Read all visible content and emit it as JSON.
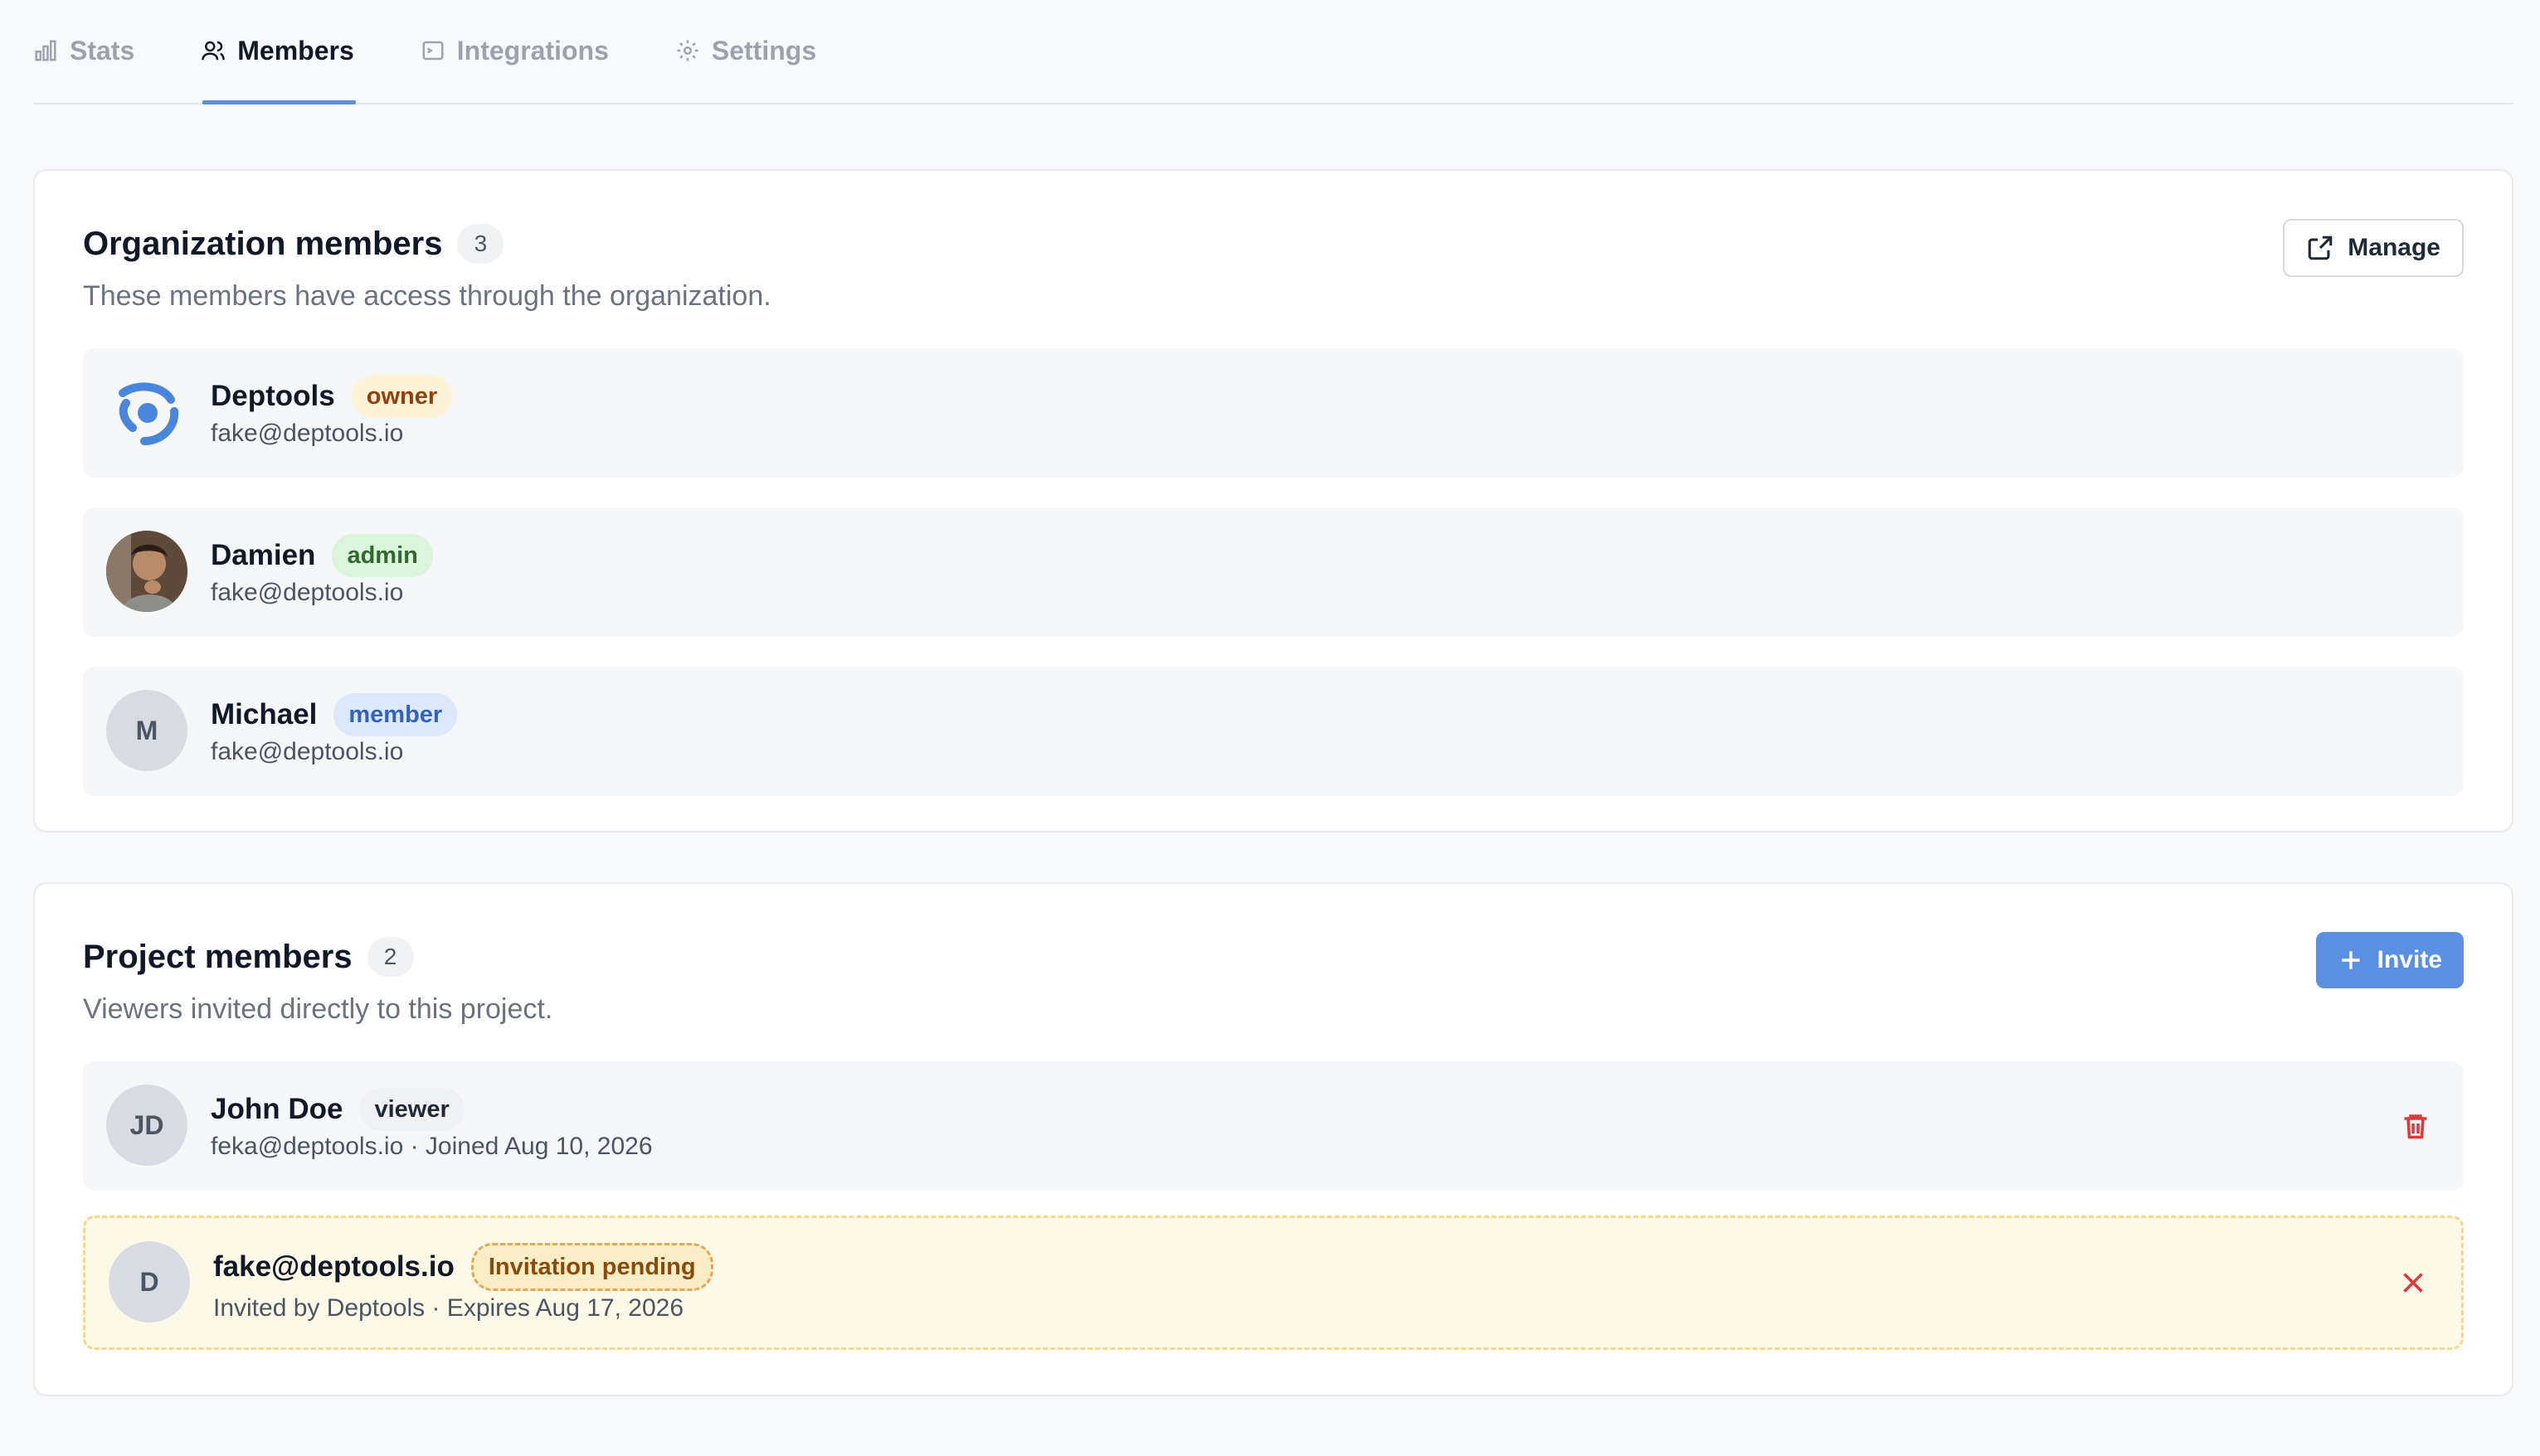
{
  "tabs": [
    {
      "label": "Stats",
      "icon": "bar-chart-icon",
      "active": false
    },
    {
      "label": "Members",
      "icon": "users-icon",
      "active": true
    },
    {
      "label": "Integrations",
      "icon": "terminal-icon",
      "active": false
    },
    {
      "label": "Settings",
      "icon": "gear-icon",
      "active": false
    }
  ],
  "org": {
    "title": "Organization members",
    "count": "3",
    "subtitle": "These members have access through the organization.",
    "manage_label": "Manage",
    "members": [
      {
        "name": "Deptools",
        "role": "owner",
        "email": "fake@deptools.io",
        "avatar": "deptools-logo"
      },
      {
        "name": "Damien",
        "role": "admin",
        "email": "fake@deptools.io",
        "avatar": "photo"
      },
      {
        "name": "Michael",
        "role": "member",
        "email": "fake@deptools.io",
        "initials": "M"
      }
    ]
  },
  "project": {
    "title": "Project members",
    "count": "2",
    "subtitle": "Viewers invited directly to this project.",
    "invite_label": "Invite",
    "members": [
      {
        "name": "John Doe",
        "role": "viewer",
        "initials": "JD",
        "detail": "feka@deptools.io · Joined Aug 10, 2026"
      },
      {
        "name": "fake@deptools.io",
        "role": "Invitation pending",
        "initials": "D",
        "detail": "Invited by Deptools · Expires Aug 17, 2026"
      }
    ]
  },
  "colors": {
    "accent": "#5b8fe0",
    "danger": "#dc3b3b",
    "pending_bg": "#fdf9e8"
  }
}
